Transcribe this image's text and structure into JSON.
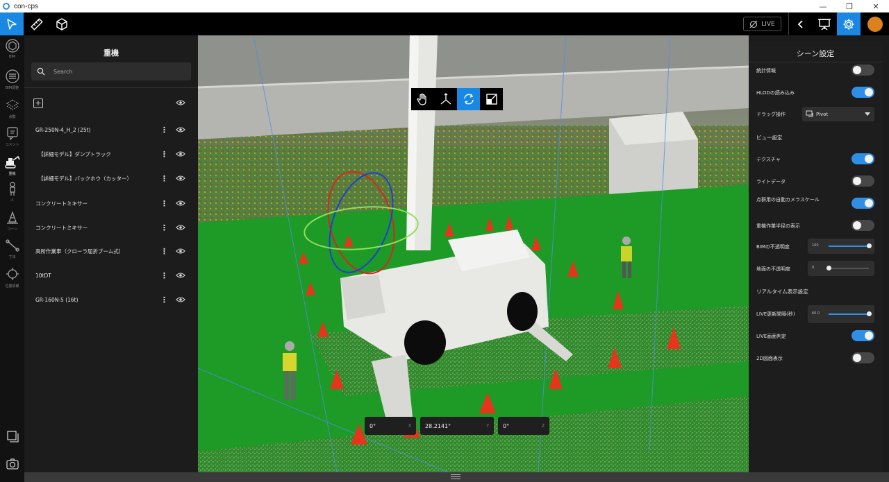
{
  "window": {
    "title": "con-cps"
  },
  "toolbar": {
    "live_label": "LIVE"
  },
  "rail": [
    {
      "name": "BIM",
      "label": "BIM"
    },
    {
      "name": "bim-adjust",
      "label": "BIM調整"
    },
    {
      "name": "pointcloud",
      "label": "点群"
    },
    {
      "name": "comment",
      "label": "コメント"
    },
    {
      "name": "heavy",
      "label": "重機"
    },
    {
      "name": "person",
      "label": "人"
    },
    {
      "name": "cone",
      "label": "コーン"
    },
    {
      "name": "measure",
      "label": "寸法"
    },
    {
      "name": "position",
      "label": "位置情報"
    }
  ],
  "panel": {
    "title": "重機",
    "search_placeholder": "Search",
    "items": [
      {
        "name": "GR-250N-4_H_2 (25t)",
        "indent": false
      },
      {
        "name": "【詳細モデル】ダンプトラック",
        "indent": true
      },
      {
        "name": "【詳細モデル】バックホウ（カッター）",
        "indent": true
      },
      {
        "name": "コンクリートミキサー",
        "indent": false
      },
      {
        "name": "コンクリートミキサー",
        "indent": false
      },
      {
        "name": "高所作業車（クローラ屈折ブーム式）",
        "indent": false
      },
      {
        "name": "10tDT",
        "indent": false
      },
      {
        "name": "GR-160N-5 (16t)",
        "indent": false
      }
    ]
  },
  "coords": [
    {
      "value": "0°",
      "axis": "X"
    },
    {
      "value": "28.2141°",
      "axis": "Y"
    },
    {
      "value": "0°",
      "axis": "Z"
    }
  ],
  "settings": {
    "title": "シーン設定",
    "rows": [
      {
        "kind": "toggle",
        "label": "統計情報",
        "on": false
      },
      {
        "kind": "toggle",
        "label": "HLODの読み込み",
        "on": true
      },
      {
        "kind": "dropdown",
        "label": "ドラッグ操作",
        "value": "Pivot"
      },
      {
        "kind": "section",
        "label": "ビュー設定"
      },
      {
        "kind": "toggle",
        "label": "テクスチャ",
        "on": true
      },
      {
        "kind": "toggle",
        "label": "ライトデータ",
        "on": false
      },
      {
        "kind": "toggle",
        "label": "点群用の自動カメラスケール",
        "on": true
      },
      {
        "kind": "toggle",
        "label": "重機作業半径の表示",
        "on": false
      },
      {
        "kind": "slider",
        "label": "BIMの不透明度",
        "value": "100",
        "level": 1.0
      },
      {
        "kind": "slider",
        "label": "地面の不透明度",
        "value": "0",
        "level": 0.0
      },
      {
        "kind": "section",
        "label": "リアルタイム表示設定"
      },
      {
        "kind": "slider",
        "label": "LIVE更新間隔(秒)",
        "value": "60.0",
        "level": 1.0
      },
      {
        "kind": "toggle",
        "label": "LIVE画面判定",
        "on": true
      },
      {
        "kind": "toggle",
        "label": "2D図面表示",
        "on": false
      }
    ]
  },
  "colors": {
    "accent": "#2f8fe6",
    "toolbar_active": "#1a88e3",
    "avatar": "#d9821e"
  }
}
